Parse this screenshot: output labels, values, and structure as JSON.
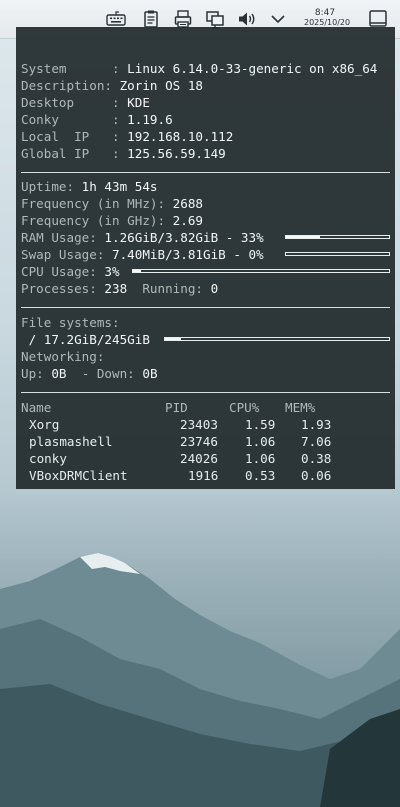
{
  "panel": {
    "clock_time": "8:47",
    "clock_date": "2025/10/20",
    "icons": [
      "keyboard-icon",
      "clipboard-icon",
      "printer-icon",
      "network-icon",
      "volume-icon",
      "chevron-down-icon",
      "show-desktop-icon"
    ]
  },
  "system": {
    "system_label": "System      :",
    "system_value": "Linux 6.14.0-33-generic on x86_64",
    "description_label": "Description:",
    "description_value": "Zorin OS 18",
    "desktop_label": "Desktop     :",
    "desktop_value": "KDE",
    "conky_label": "Conky       :",
    "conky_value": "1.19.6",
    "local_ip_label": "Local  IP   :",
    "local_ip_value": "192.168.10.112",
    "global_ip_label": "Global IP   :",
    "global_ip_value": "125.56.59.149"
  },
  "stats": {
    "uptime_label": "Uptime:",
    "uptime_value": "1h 43m 54s",
    "freq_mhz_label": "Frequency (in MHz):",
    "freq_mhz_value": "2688",
    "freq_ghz_label": "Frequency (in GHz):",
    "freq_ghz_value": "2.69",
    "ram_label": "RAM Usage:",
    "ram_value": "1.26GiB/3.82GiB - 33%",
    "ram_fraction": 0.33,
    "swap_label": "Swap Usage:",
    "swap_value": "7.40MiB/3.81GiB - 0%",
    "swap_fraction": 0.0,
    "cpu_label": "CPU Usage:",
    "cpu_value": "3%",
    "cpu_fraction": 0.03,
    "processes_label": "Processes:",
    "processes_value": "238",
    "running_label": "Running:",
    "running_value": "0"
  },
  "filesystems": {
    "label": "File systems:",
    "root_value": " / 17.2GiB/245GiB",
    "root_fraction": 0.07,
    "networking_label": "Networking:",
    "up_label": "Up:",
    "up_value": "0B",
    "down_label": "- Down:",
    "down_value": "0B"
  },
  "processes": {
    "headers": {
      "name": "Name",
      "pid": "PID",
      "cpu": "CPU%",
      "mem": "MEM%"
    },
    "rows": [
      {
        "name": "Xorg",
        "pid": "23403",
        "cpu": "1.59",
        "mem": "1.93"
      },
      {
        "name": "plasmashell",
        "pid": "23746",
        "cpu": "1.06",
        "mem": "7.06"
      },
      {
        "name": "conky",
        "pid": "24026",
        "cpu": "1.06",
        "mem": "0.38"
      },
      {
        "name": "VBoxDRMClient",
        "pid": "1916",
        "cpu": "0.53",
        "mem": "0.06"
      }
    ]
  }
}
